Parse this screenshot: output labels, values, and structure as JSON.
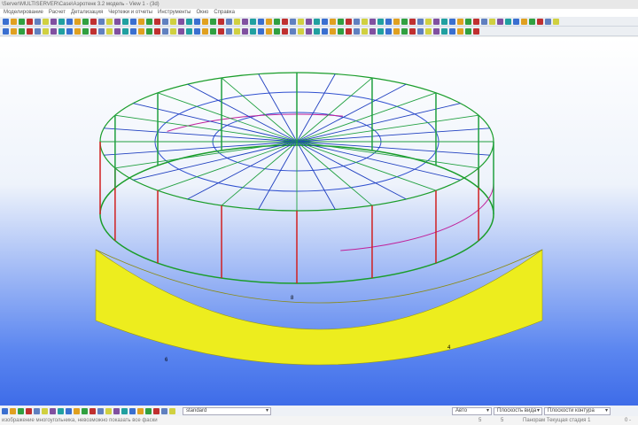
{
  "title": "\\Server\\MULTISERVER\\Case\\Аэротенк 3.2 модель  - View 1 - (3d)",
  "menu": [
    "Моделирование",
    "Расчет",
    "Детализация",
    "Чертежи и отчеты",
    "Инструменты",
    "Окно",
    "Справка"
  ],
  "bottom": {
    "standard": "standard",
    "auto": "Авто",
    "view_plane": "Плоскость вида",
    "contour_plane": "Плоскости контура"
  },
  "status": {
    "message": "изображение многоугольника, невозможно показать все фаски",
    "n1": "5",
    "n2": "5",
    "mode": "Панорам Текущая стадия 1",
    "coord": "0 -"
  },
  "labels": {
    "a": "6",
    "b": "4",
    "c": "8"
  },
  "colors": {
    "wall": "#f2f21a",
    "background": "#5b86f0"
  }
}
